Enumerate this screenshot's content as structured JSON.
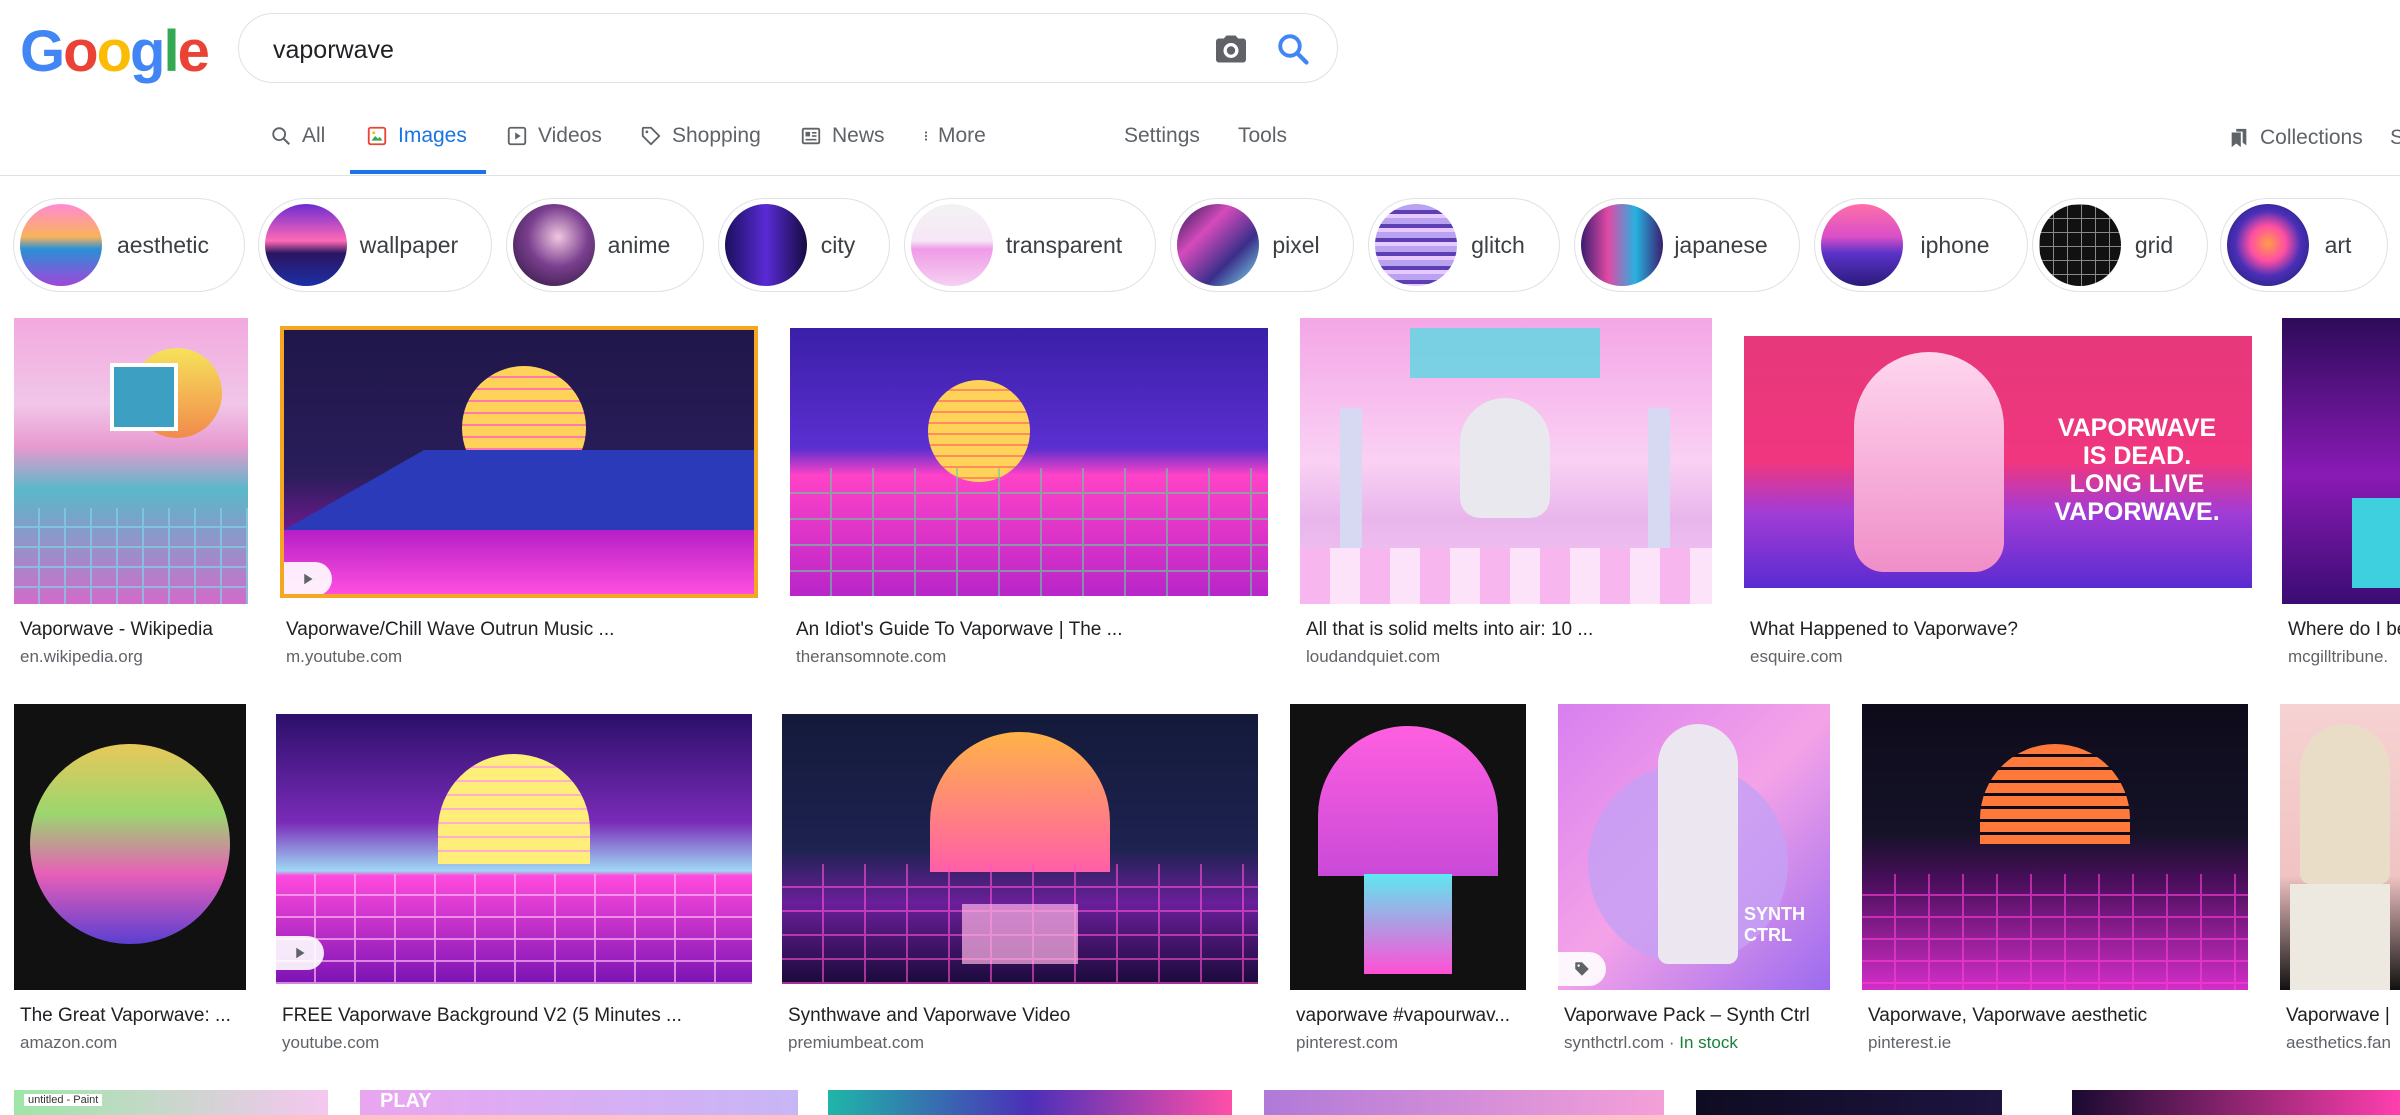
{
  "logo": {
    "letters": [
      "G",
      "o",
      "o",
      "g",
      "l",
      "e"
    ],
    "colors": [
      "#4285f4",
      "#ea4335",
      "#fbbc05",
      "#4285f4",
      "#34a853",
      "#ea4335"
    ]
  },
  "search": {
    "value": "vaporwave"
  },
  "tabs": [
    {
      "label": "All",
      "icon": "search-icon"
    },
    {
      "label": "Images",
      "icon": "image-icon",
      "active": true
    },
    {
      "label": "Videos",
      "icon": "play-icon"
    },
    {
      "label": "Shopping",
      "icon": "tag-icon"
    },
    {
      "label": "News",
      "icon": "news-icon"
    },
    {
      "label": "More",
      "icon": "more-vertical-icon"
    },
    {
      "label": "Settings"
    },
    {
      "label": "Tools"
    }
  ],
  "collections": {
    "label": "Collections",
    "icon": "bookmark-icon",
    "cut_label": "S"
  },
  "chips": [
    {
      "label": "aesthetic"
    },
    {
      "label": "wallpaper"
    },
    {
      "label": "anime"
    },
    {
      "label": "city"
    },
    {
      "label": "transparent"
    },
    {
      "label": "pixel"
    },
    {
      "label": "glitch"
    },
    {
      "label": "japanese"
    },
    {
      "label": "iphone"
    },
    {
      "label": "grid"
    },
    {
      "label": "art"
    }
  ],
  "results": [
    {
      "title": "Vaporwave - Wikipedia",
      "source": "en.wikipedia.org"
    },
    {
      "title": "Vaporwave/Chill Wave Outrun Music ...",
      "source": "m.youtube.com",
      "badge": "play"
    },
    {
      "title": "An Idiot's Guide To Vaporwave | The ...",
      "source": "theransomnote.com"
    },
    {
      "title": "All that is solid melts into air: 10 ...",
      "source": "loudandquiet.com"
    },
    {
      "title": "What Happened to Vaporwave?",
      "source": "esquire.com"
    },
    {
      "title": "Where do I be",
      "source": "mcgilltribune."
    },
    {
      "title": "The Great Vaporwave: ...",
      "source": "amazon.com"
    },
    {
      "title": "FREE Vaporwave Background V2 (5 Minutes ...",
      "source": "youtube.com",
      "badge": "play"
    },
    {
      "title": "Synthwave and Vaporwave Video",
      "source": "premiumbeat.com"
    },
    {
      "title": "vaporwave #vapourwav...",
      "source": "pinterest.com"
    },
    {
      "title": "Vaporwave Pack – Synth Ctrl",
      "source": "synthctrl.com",
      "stock": "In stock",
      "badge": "tag"
    },
    {
      "title": "Vaporwave, Vaporwave aesthetic",
      "source": "pinterest.ie"
    },
    {
      "title": "Vaporwave |",
      "source": "aesthetics.fan"
    }
  ],
  "image_texts": {
    "esquire": [
      "VAPORWAVE",
      "IS DEAD.",
      "LONG LIVE",
      "VAPORWAVE."
    ],
    "synth": "SYNTH CTRL",
    "paint": "untitled - Paint",
    "play": "PLAY"
  }
}
